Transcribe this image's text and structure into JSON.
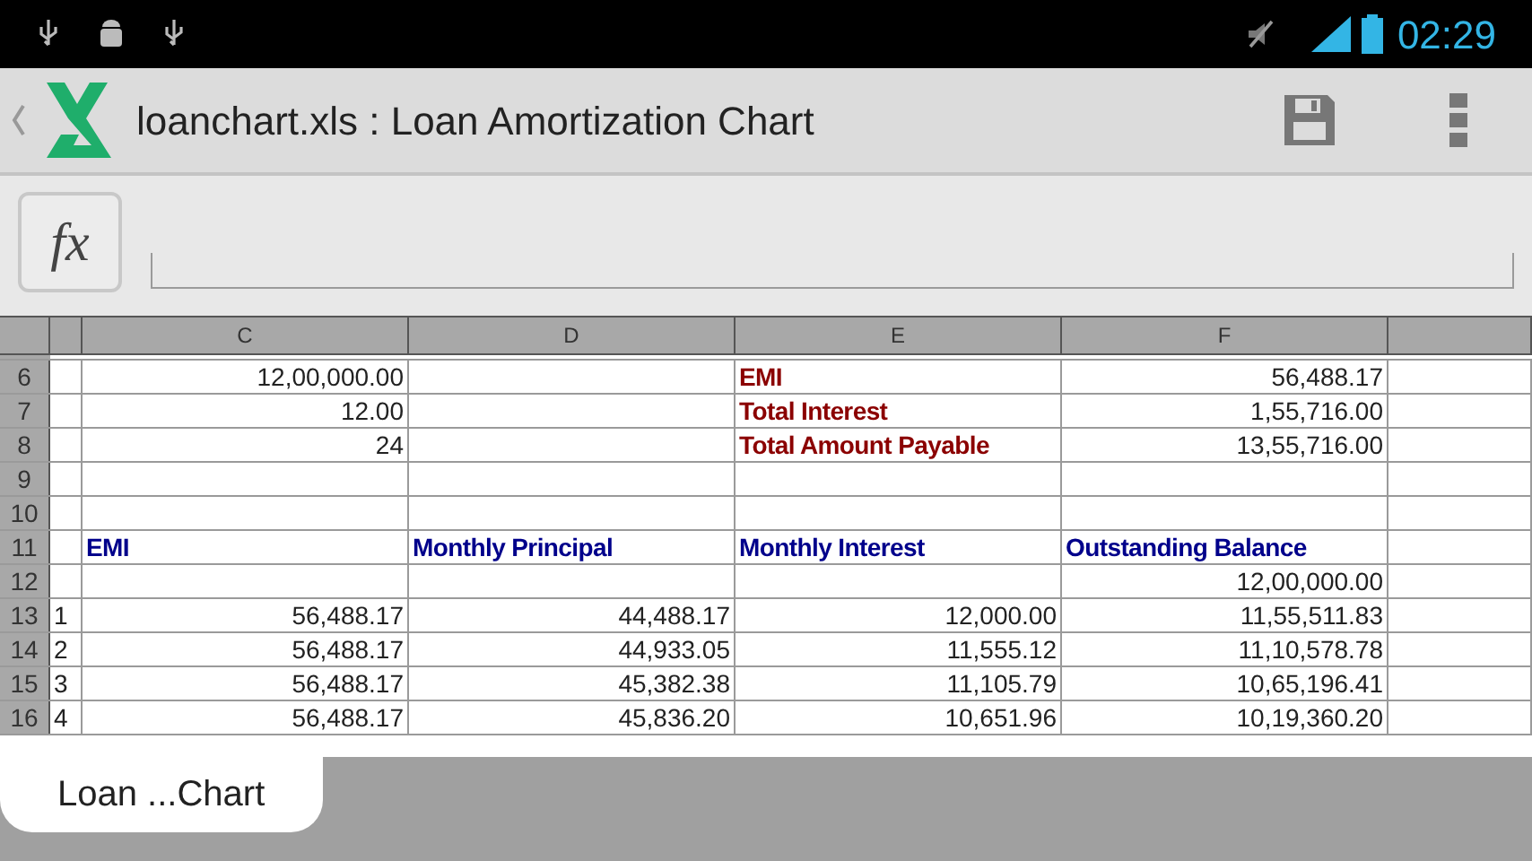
{
  "status_bar": {
    "time": "02:29"
  },
  "action_bar": {
    "title": "loanchart.xls : Loan Amortization Chart"
  },
  "formula_bar": {
    "button": "fx"
  },
  "sheet": {
    "columns": [
      "",
      "C",
      "D",
      "E",
      "F",
      ""
    ],
    "rows": [
      {
        "kind": "summary",
        "num": "6",
        "cells": [
          "",
          "12,00,000.00",
          "",
          "EMI",
          "56,488.17",
          ""
        ]
      },
      {
        "kind": "summary",
        "num": "7",
        "cells": [
          "",
          "12.00",
          "",
          "Total Interest",
          "1,55,716.00",
          ""
        ]
      },
      {
        "kind": "summary",
        "num": "8",
        "cells": [
          "",
          "24",
          "",
          "Total Amount Payable",
          "13,55,716.00",
          ""
        ]
      },
      {
        "kind": "data",
        "num": "9",
        "cells": [
          "",
          "",
          "",
          "",
          "",
          ""
        ]
      },
      {
        "kind": "data",
        "num": "10",
        "cells": [
          "",
          "",
          "",
          "",
          "",
          ""
        ]
      },
      {
        "kind": "header",
        "num": "11",
        "cells": [
          "",
          "EMI",
          "Monthly Principal",
          "Monthly Interest",
          "Outstanding Balance",
          ""
        ]
      },
      {
        "kind": "data",
        "num": "12",
        "cells": [
          "",
          "",
          "",
          "",
          "12,00,000.00",
          ""
        ]
      },
      {
        "kind": "data",
        "num": "13",
        "cells": [
          "1",
          "56,488.17",
          "44,488.17",
          "12,000.00",
          "11,55,511.83",
          ""
        ]
      },
      {
        "kind": "data",
        "num": "14",
        "cells": [
          "2",
          "56,488.17",
          "44,933.05",
          "11,555.12",
          "11,10,578.78",
          ""
        ]
      },
      {
        "kind": "data",
        "num": "15",
        "cells": [
          "3",
          "56,488.17",
          "45,382.38",
          "11,105.79",
          "10,65,196.41",
          ""
        ]
      },
      {
        "kind": "data",
        "num": "16",
        "cells": [
          "4",
          "56,488.17",
          "45,836.20",
          "10,651.96",
          "10,19,360.20",
          ""
        ]
      }
    ]
  },
  "sheet_tabs": [
    {
      "label": "Loan ...Chart",
      "selected": true
    }
  ]
}
